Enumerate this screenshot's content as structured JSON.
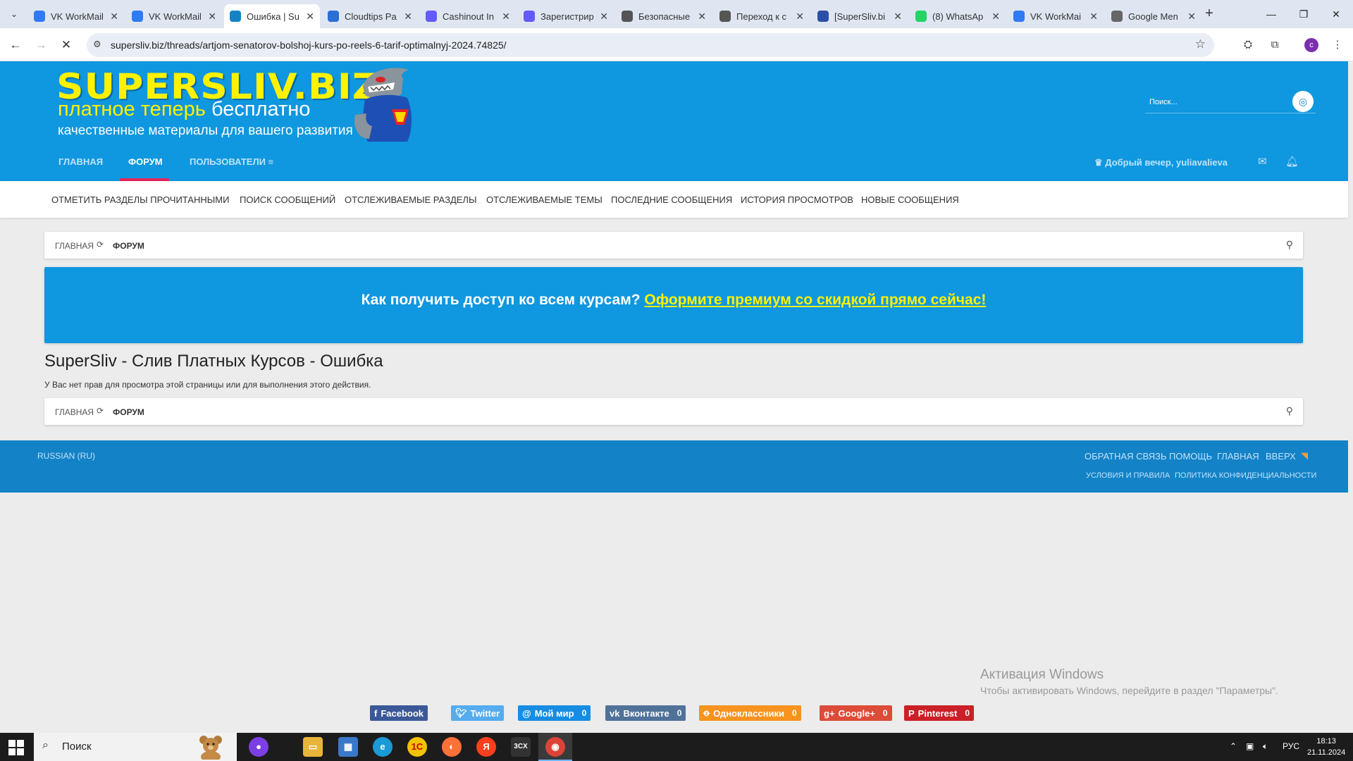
{
  "browser": {
    "tabs": [
      {
        "title": "VK WorkMail",
        "icon": "shield-icon",
        "color": "#2f7bf5"
      },
      {
        "title": "VK WorkMail",
        "icon": "shield-icon",
        "color": "#2f7bf5"
      },
      {
        "title": "Ошибка | Su",
        "icon": "supersliv-icon",
        "color": "#1482c6",
        "active": true
      },
      {
        "title": "Cloudtips Pa",
        "icon": "cloudtips-icon",
        "color": "#2a6fd6"
      },
      {
        "title": "Cashinout In",
        "icon": "stripe-icon",
        "color": "#635bff"
      },
      {
        "title": "Зарегистрир",
        "icon": "stripe-icon",
        "color": "#635bff"
      },
      {
        "title": "Безопасные",
        "icon": "globe-icon",
        "color": "#555555"
      },
      {
        "title": "Переход к с",
        "icon": "globe-icon",
        "color": "#555555"
      },
      {
        "title": "[SuperSliv.bi",
        "icon": "tab-icon",
        "color": "#2b4fa8"
      },
      {
        "title": "(8) WhatsAp",
        "icon": "whatsapp-icon",
        "color": "#25d366"
      },
      {
        "title": "VK WorkMai",
        "icon": "shield-icon",
        "color": "#2f7bf5"
      },
      {
        "title": "Google Men",
        "icon": "google-icon",
        "color": "#666666"
      }
    ],
    "url": "supersliv.biz/threads/artjom-senatorov-bolshoj-kurs-po-reels-6-tarif-optimalnyj-2024.74825/",
    "profile_initial": "c"
  },
  "site": {
    "logo": {
      "main": "SUPERSLIV.BIZ",
      "sub_yellow": "платное теперь",
      "sub_white": "бесплатно",
      "tagline": "качественные материалы для вашего развития"
    },
    "search_placeholder": "Поиск...",
    "nav": {
      "home": "Главная",
      "forum": "Форум",
      "users": "Пользователи"
    },
    "greeting": "Добрый вечер, yuliavalieva",
    "subnav": [
      "Отметить разделы прочитанными",
      "Поиск сообщений",
      "Отслеживаемые разделы",
      "Отслеживаемые темы",
      "Последние сообщения",
      "История просмотров",
      "Новые сообщения"
    ],
    "breadcrumb": {
      "home": "Главная",
      "forum": "Форум"
    },
    "promo": {
      "question": "Как получить доступ ко всем курсам?",
      "link": "Оформите премиум со скидкой прямо сейчас!"
    },
    "page_title": "SuperSliv - Слив Платных Курсов - Ошибка",
    "error_message": "У Вас нет прав для просмотра этой страницы или для выполнения этого действия.",
    "footer": {
      "language": "Russian (RU)",
      "links": [
        "Обратная связь",
        "Помощь",
        "Главная",
        "Вверх"
      ],
      "sublinks": [
        "Условия и правила",
        "Политика конфиденциальности"
      ]
    },
    "share": [
      {
        "label": "Facebook",
        "color": "#3b5998",
        "icon": "facebook-icon"
      },
      {
        "label": "Twitter",
        "color": "#55acee",
        "icon": "twitter-icon"
      },
      {
        "label": "Мой мир",
        "count": "0",
        "color": "#168de2",
        "icon": "mymir-icon"
      },
      {
        "label": "Вконтакте",
        "count": "0",
        "color": "#507299",
        "icon": "vk-icon"
      },
      {
        "label": "Одноклассники",
        "count": "0",
        "color": "#f7931e",
        "icon": "ok-icon"
      },
      {
        "label": "Google+",
        "count": "0",
        "color": "#dd4b39",
        "icon": "googleplus-icon"
      },
      {
        "label": "Pinterest",
        "count": "0",
        "color": "#cb2027",
        "icon": "pinterest-icon"
      }
    ]
  },
  "windows": {
    "activation_title": "Активация Windows",
    "activation_sub": "Чтобы активировать Windows, перейдите в раздел \"Параметры\".",
    "search_text": "Поиск",
    "lang": "РУС",
    "time": "18:13",
    "date": "21.11.2024"
  }
}
